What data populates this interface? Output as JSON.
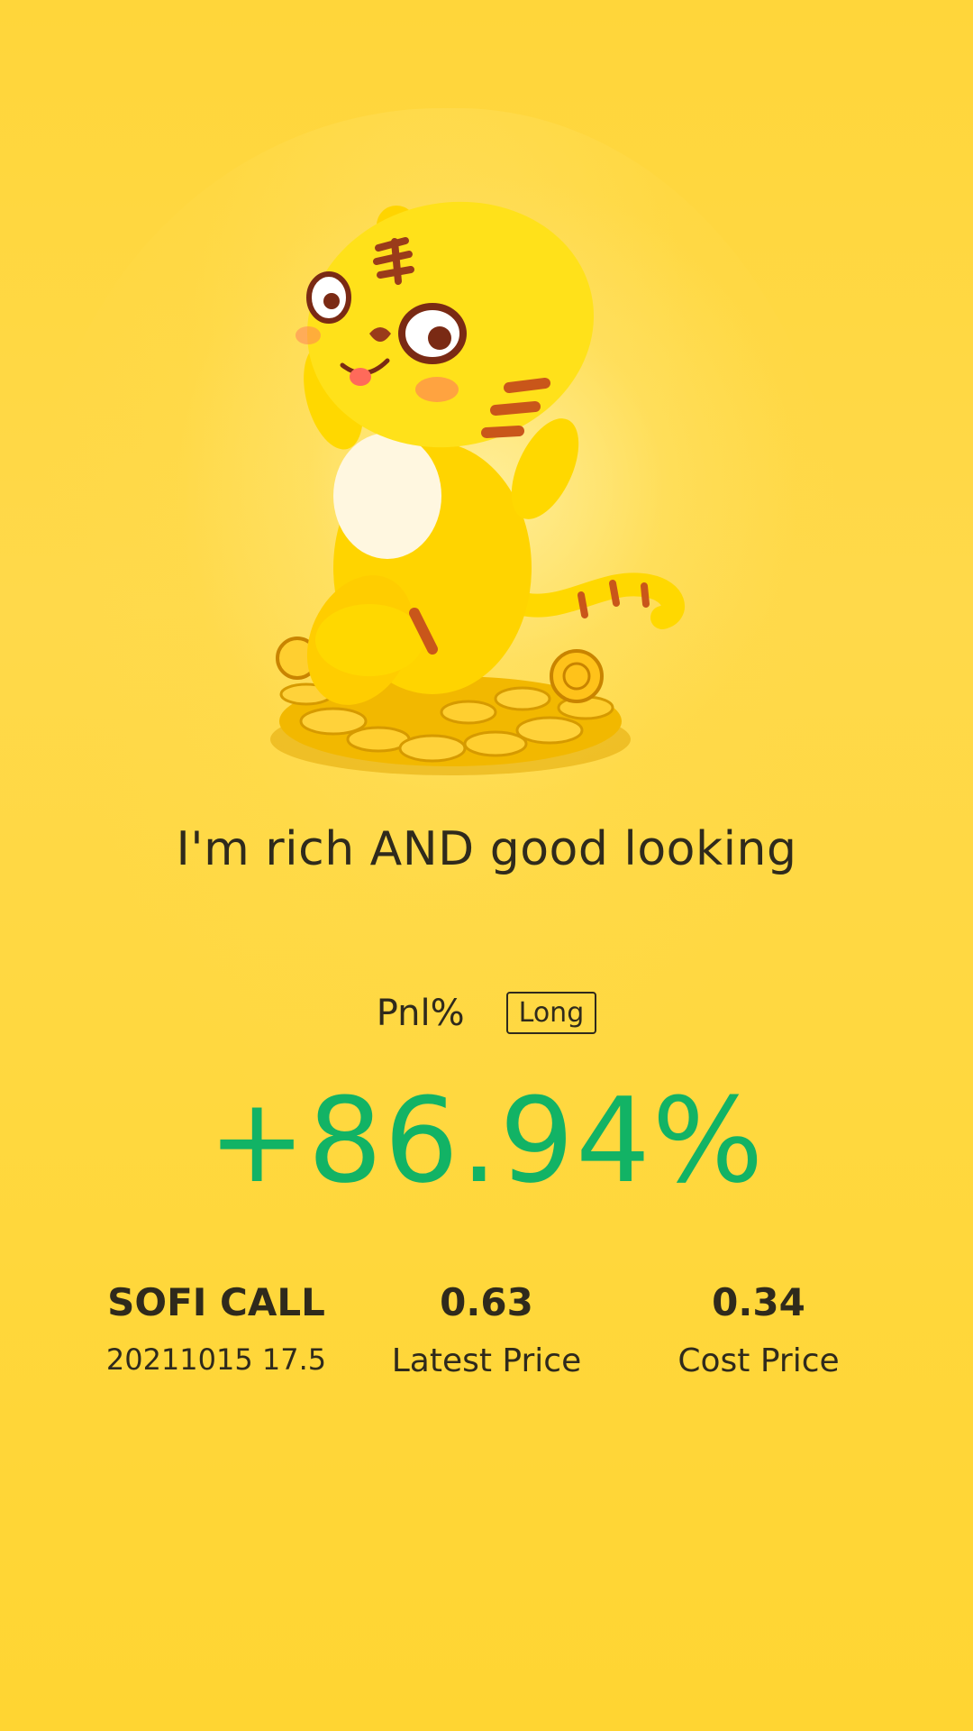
{
  "headline": "I'm rich AND good looking",
  "pnl": {
    "label": "Pnl%",
    "direction_badge": "Long",
    "value": "+86.94%",
    "value_color": "#12b365"
  },
  "instrument": {
    "name": "SOFI CALL",
    "detail": "20211015 17.5"
  },
  "latest_price": {
    "value": "0.63",
    "label": "Latest Price"
  },
  "cost_price": {
    "value": "0.34",
    "label": "Cost Price"
  },
  "colors": {
    "background": "#ffd63a",
    "text": "#2f2a1c",
    "gain": "#12b365"
  },
  "illustration": {
    "icon": "tiger-mascot-on-gold-coins-illustration"
  }
}
